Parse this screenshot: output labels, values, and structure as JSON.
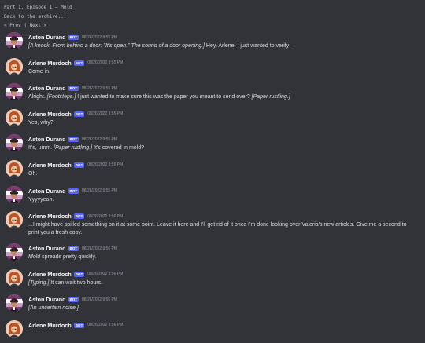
{
  "header": {
    "title": "Part 1, Episode 1 — Mold",
    "back_label": "Back to the archive...",
    "prev_label": "< Prev",
    "sep": "|",
    "next_label": "Next >"
  },
  "badge_label": "BOT",
  "colors": {
    "background": "#313338",
    "bot_badge": "#5865f2",
    "author": "#f2f3f5",
    "timestamp": "#949ba4"
  },
  "messages": [
    {
      "author": "Aston Durand",
      "avatar": "aston-avatar",
      "time": "08/26/2022 9:55 PM",
      "parts": [
        [
          "i",
          "[A knock. From behind a door: \"It's open.\" The sound of a door opening.]"
        ],
        [
          "t",
          " Hey, Arlene, I just wanted to verify—"
        ]
      ]
    },
    {
      "author": "Arlene Murdoch",
      "avatar": "arlene-avatar",
      "time": "08/26/2022 9:55 PM",
      "parts": [
        [
          "t",
          "Come in."
        ]
      ]
    },
    {
      "author": "Aston Durand",
      "avatar": "aston-avatar",
      "time": "08/26/2022 9:55 PM",
      "parts": [
        [
          "t",
          "Alright. "
        ],
        [
          "i",
          "[Footsteps.]"
        ],
        [
          "t",
          " I just wanted to make sure this was the paper you meant to send over? "
        ],
        [
          "i",
          "[Paper rustling.]"
        ]
      ]
    },
    {
      "author": "Arlene Murdoch",
      "avatar": "arlene-avatar",
      "time": "08/26/2022 9:55 PM",
      "parts": [
        [
          "t",
          "Yes, why?"
        ]
      ]
    },
    {
      "author": "Aston Durand",
      "avatar": "aston-avatar",
      "time": "08/26/2022 9:55 PM",
      "parts": [
        [
          "t",
          "It's, umm. "
        ],
        [
          "i",
          "[Paper rustling.]"
        ],
        [
          "t",
          " It's covered in mold?"
        ]
      ]
    },
    {
      "author": "Arlene Murdoch",
      "avatar": "arlene-avatar",
      "time": "08/26/2022 9:55 PM",
      "parts": [
        [
          "t",
          "Oh."
        ]
      ]
    },
    {
      "author": "Aston Durand",
      "avatar": "aston-avatar",
      "time": "08/26/2022 9:55 PM",
      "parts": [
        [
          "t",
          "Yyyyyeah."
        ]
      ]
    },
    {
      "author": "Arlene Murdoch",
      "avatar": "arlene-avatar",
      "time": "08/26/2022 9:56 PM",
      "tall": true,
      "parts": [
        [
          "t",
          "...I might have spilled something on it at some point. Leave it here and I'll get rid of it once I'm done looking over Valeria's new articles. Give me a second to print you a fresh copy."
        ]
      ]
    },
    {
      "author": "Aston Durand",
      "avatar": "aston-avatar",
      "time": "08/26/2022 9:56 PM",
      "parts": [
        [
          "i",
          "Mold"
        ],
        [
          "t",
          " spreads pretty quickly."
        ]
      ]
    },
    {
      "author": "Arlene Murdoch",
      "avatar": "arlene-avatar",
      "time": "08/26/2022 9:56 PM",
      "parts": [
        [
          "i",
          "[Typing.]"
        ],
        [
          "t",
          " It can wait two hours."
        ]
      ]
    },
    {
      "author": "Aston Durand",
      "avatar": "aston-avatar",
      "time": "08/26/2022 9:56 PM",
      "parts": [
        [
          "i",
          "[An uncertain noise.]"
        ]
      ]
    },
    {
      "author": "Arlene Murdoch",
      "avatar": "arlene-avatar",
      "time": "08/26/2022 9:56 PM",
      "parts": []
    }
  ]
}
